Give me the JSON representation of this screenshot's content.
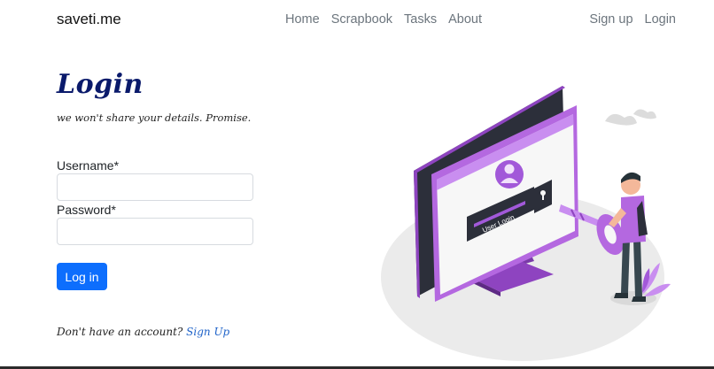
{
  "nav": {
    "brand": "saveti.me",
    "links": [
      "Home",
      "Scrapbook",
      "Tasks",
      "About"
    ],
    "auth": [
      "Sign up",
      "Login"
    ]
  },
  "login": {
    "title": "Login",
    "subtitle": "we won't share your details. Promise.",
    "username_label": "Username*",
    "username_value": "",
    "password_label": "Password*",
    "password_value": "",
    "submit_label": "Log in",
    "no_account_text": "Don't have an account?",
    "signup_link": "Sign Up"
  },
  "illustration": {
    "screen_label": "User Login"
  },
  "colors": {
    "accent": "#0d6efd",
    "title": "#0a1a6b",
    "illustration_purple": "#a259d9",
    "illustration_dark": "#2c2f3a"
  }
}
